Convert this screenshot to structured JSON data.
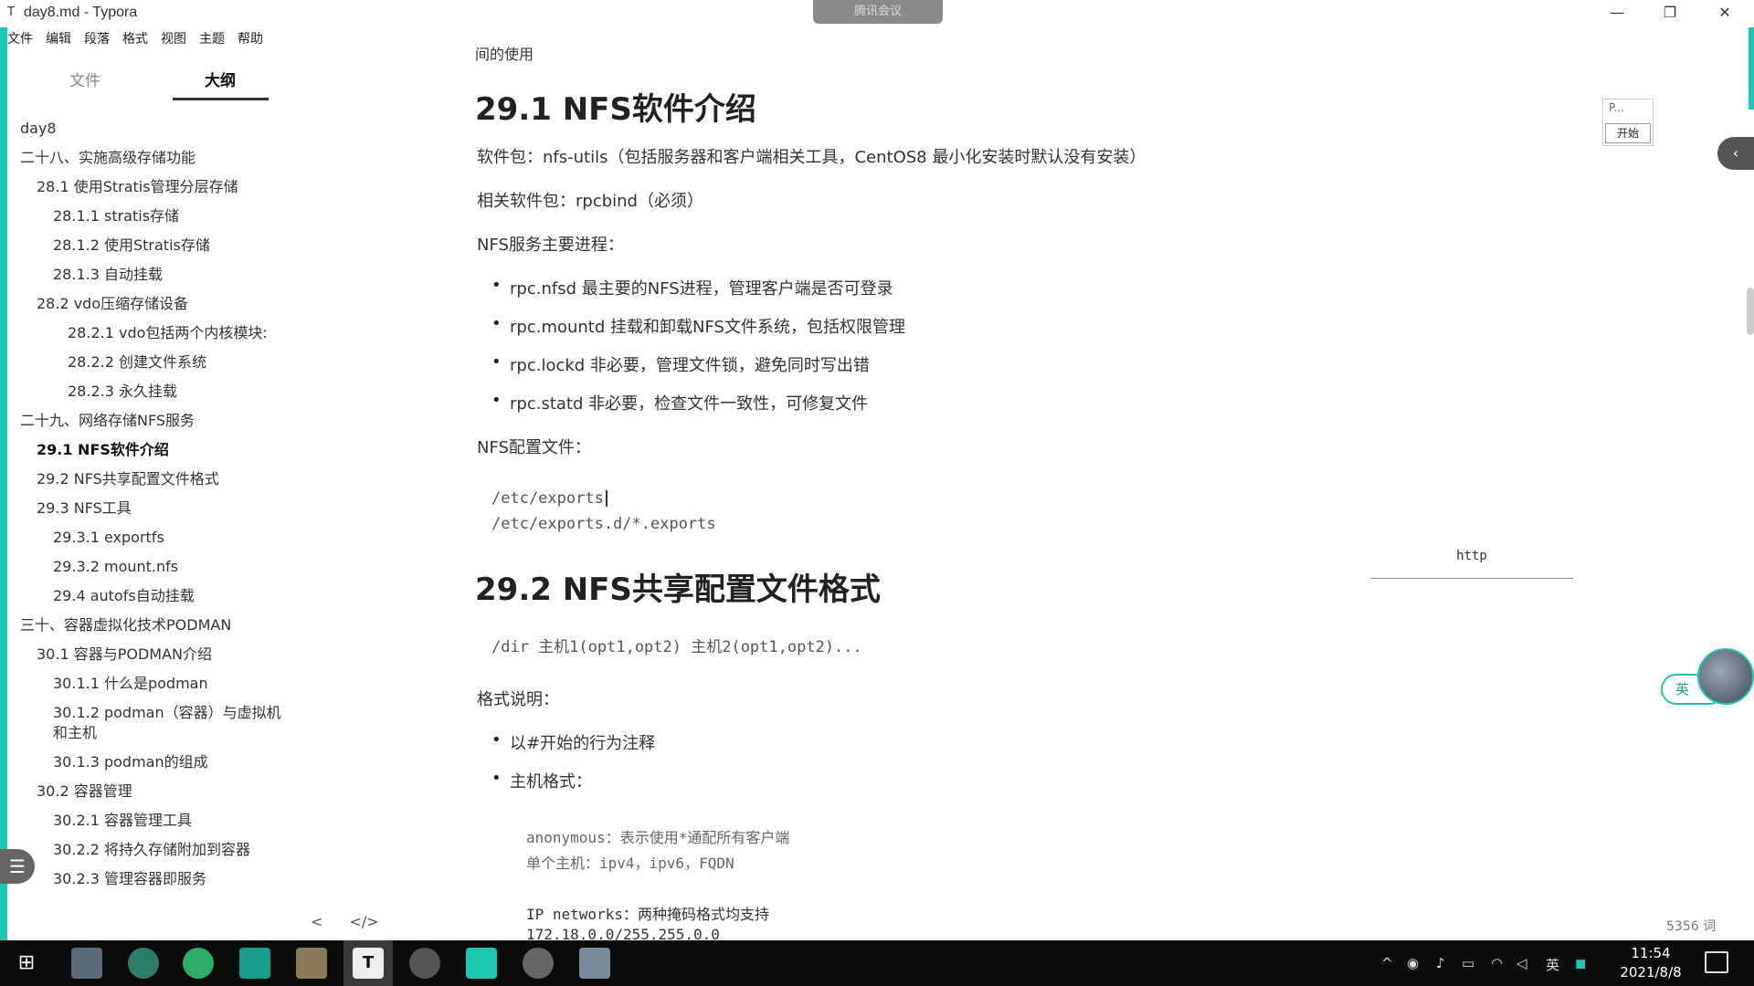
{
  "window": {
    "title": "day8.md - Typora",
    "meeting_badge": "腾讯会议",
    "min": "—",
    "max": "❐",
    "close": "✕"
  },
  "menu": [
    "文件",
    "编辑",
    "段落",
    "格式",
    "视图",
    "主题",
    "帮助"
  ],
  "sidebar": {
    "tabs": [
      "文件",
      "大纲"
    ],
    "active_tab": "大纲",
    "outline": [
      {
        "label": "day8",
        "level": 0
      },
      {
        "label": "二十八、实施高级存储功能",
        "level": 0
      },
      {
        "label": "28.1 使用Stratis管理分层存储",
        "level": 1
      },
      {
        "label": "28.1.1 stratis存储",
        "level": 2
      },
      {
        "label": "28.1.2 使用Stratis存储",
        "level": 2
      },
      {
        "label": "28.1.3 自动挂载",
        "level": 2
      },
      {
        "label": "28.2 vdo压缩存储设备",
        "level": 1
      },
      {
        "label": "28.2.1 vdo包括两个内核模块:",
        "level": 3
      },
      {
        "label": "28.2.2 创建文件系统",
        "level": 3
      },
      {
        "label": "28.2.3 永久挂载",
        "level": 3
      },
      {
        "label": "二十九、网络存储NFS服务",
        "level": 0
      },
      {
        "label": "29.1 NFS软件介绍",
        "level": 1,
        "bold": true
      },
      {
        "label": "29.2 NFS共享配置文件格式",
        "level": 1
      },
      {
        "label": "29.3 NFS工具",
        "level": 1
      },
      {
        "label": "29.3.1 exportfs",
        "level": 2
      },
      {
        "label": "29.3.2 mount.nfs",
        "level": 2
      },
      {
        "label": "29.4 autofs自动挂载",
        "level": 2
      },
      {
        "label": "三十、容器虚拟化技术PODMAN",
        "level": 0
      },
      {
        "label": "30.1 容器与PODMAN介绍",
        "level": 1
      },
      {
        "label": "30.1.1 什么是podman",
        "level": 2
      },
      {
        "label": "30.1.2 podman（容器）与虚拟机",
        "level": 2
      },
      {
        "label": "和主机",
        "level": 2
      },
      {
        "label": "30.1.3 podman的组成",
        "level": 2
      },
      {
        "label": "30.2 容器管理",
        "level": 1
      },
      {
        "label": "30.2.1 容器管理工具",
        "level": 2
      },
      {
        "label": "30.2.2 将持久存储附加到容器",
        "level": 2
      },
      {
        "label": "30.2.3 管理容器即服务",
        "level": 2
      }
    ],
    "footer_back": "<",
    "footer_source": "</>"
  },
  "content": {
    "clipped_top": "间的使用",
    "h_29_1": "29.1 NFS软件介绍",
    "pkg": "软件包：nfs-utils（包括服务器和客户端相关工具，CentOS8 最小化安装时默认没有安装）",
    "related_pkg": "相关软件包：rpcbind（必须）",
    "procs_title": "NFS服务主要进程：",
    "procs": [
      "rpc.nfsd 最主要的NFS进程，管理客户端是否可登录",
      "rpc.mountd 挂载和卸载NFS文件系统，包括权限管理",
      "rpc.lockd 非必要，管理文件锁，避免同时写出错",
      "rpc.statd 非必要，检查文件一致性，可修复文件"
    ],
    "conf_title": "NFS配置文件：",
    "conf_lines": [
      "/etc/exports",
      "/etc/exports.d/*.exports"
    ],
    "h_29_2": "29.2 NFS共享配置文件格式",
    "format_line": "/dir 主机1(opt1,opt2) 主机2(opt1,opt2)...",
    "fmt_title": "格式说明：",
    "fmt_bullets": [
      "以#开始的行为注释",
      "主机格式："
    ],
    "host_lines": [
      "anonymous：表示使用*通配所有客户端",
      "单个主机：ipv4，ipv6，FQDN",
      "IP networks：两种掩码格式均支持",
      "172.18.0.0/255.255.0.0"
    ]
  },
  "right": {
    "mini_panel_text": "P...",
    "mini_panel_btn": "开始",
    "http_label": "http",
    "ime_label": "英",
    "word_count": "5356 词"
  },
  "taskbar": {
    "time": "11:54",
    "date": "2021/8/8",
    "ime": "英"
  },
  "colors": {
    "accent": "#1fc7b0",
    "taskbar": "#0c0c0c"
  }
}
